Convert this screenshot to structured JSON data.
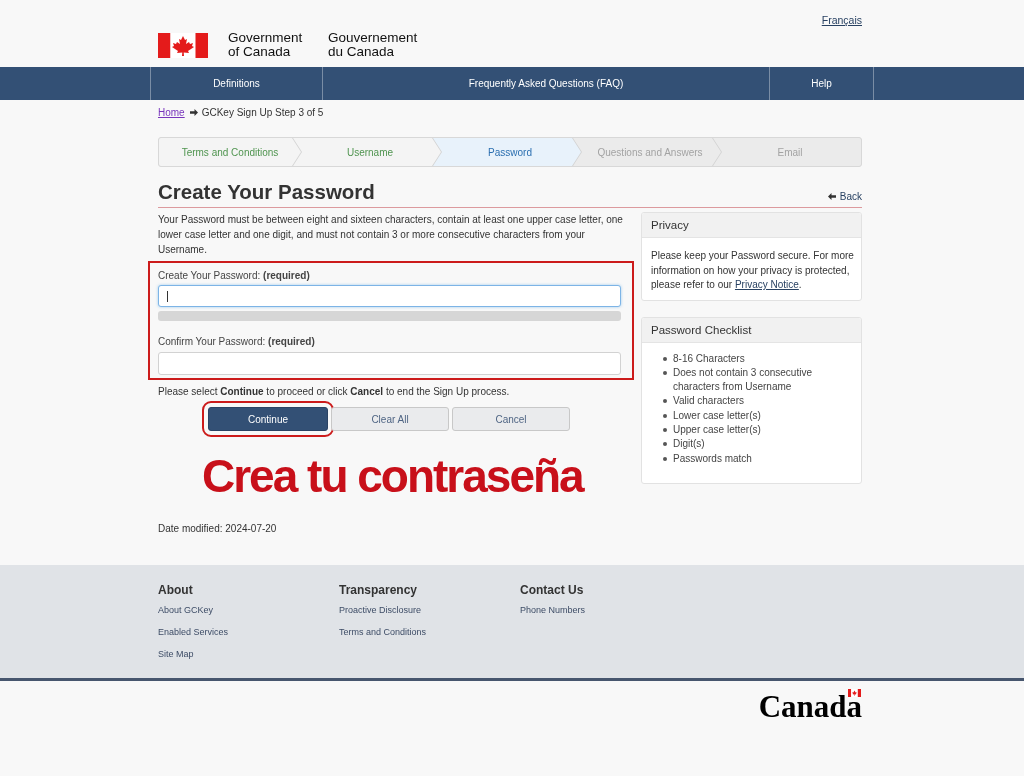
{
  "header": {
    "language_link": "Français",
    "signature_en": "Government of Canada",
    "signature_fr": "Gouvernement du Canada"
  },
  "nav": [
    {
      "label": "Definitions"
    },
    {
      "label": "Frequently Asked Questions (FAQ)"
    },
    {
      "label": "Help"
    }
  ],
  "breadcrumb": {
    "home": "Home",
    "current": "GCKey Sign Up Step 3 of 5"
  },
  "steps": [
    {
      "label": "Terms and Conditions",
      "selected": false
    },
    {
      "label": "Username",
      "selected": false
    },
    {
      "label": "Password",
      "selected": true
    },
    {
      "label": "Questions and Answers",
      "selected": false
    },
    {
      "label": "Email",
      "selected": false
    }
  ],
  "page": {
    "title": "Create Your Password",
    "back_link": "Back",
    "intro": "Your Password must be between eight and sixteen characters, contain at least one upper case letter, one lower case letter and one digit, and must not contain 3 or more consecutive characters from your Username."
  },
  "form": {
    "highlighted": true,
    "fields": [
      {
        "label": "Create Your Password: **(required)**",
        "focused": true,
        "strength_meter": true
      },
      {
        "label": "Confirm Your Password: **(required)**",
        "focused": false
      }
    ],
    "instruction": "Please select **Continue** to proceed or click **Cancel** to end the Sign Up process."
  },
  "buttons": [
    {
      "label": "Continue",
      "kind": "primary",
      "highlighted": true
    },
    {
      "label": "Clear All",
      "kind": "secondary",
      "highlighted": false
    },
    {
      "label": "Cancel",
      "kind": "secondary",
      "highlighted": false
    }
  ],
  "annotation": "Crea tu contraseña",
  "date_modified": "Date modified: 2024-07-20",
  "sidebar": [
    {
      "kind": "text",
      "title": "Privacy",
      "text": "Please keep your Password secure. For more information on how your privacy is protected, please refer to our ",
      "link": "Privacy Notice",
      "text_after": "."
    },
    {
      "kind": "list",
      "title": "Password Checklist",
      "items": [
        "8-16 Characters",
        "Does not contain 3 consecutive characters from Username",
        "Valid characters",
        "Lower case letter(s)",
        "Upper case letter(s)",
        "Digit(s)",
        "Passwords match"
      ]
    }
  ],
  "footer": [
    {
      "heading": "About",
      "links": [
        "About GCKey",
        "Enabled Services",
        "Site Map"
      ]
    },
    {
      "heading": "Transparency",
      "links": [
        "Proactive Disclosure",
        "Terms and Conditions"
      ]
    },
    {
      "heading": "Contact Us",
      "links": [
        "Phone Numbers"
      ]
    }
  ],
  "wordmark": "Canada"
}
